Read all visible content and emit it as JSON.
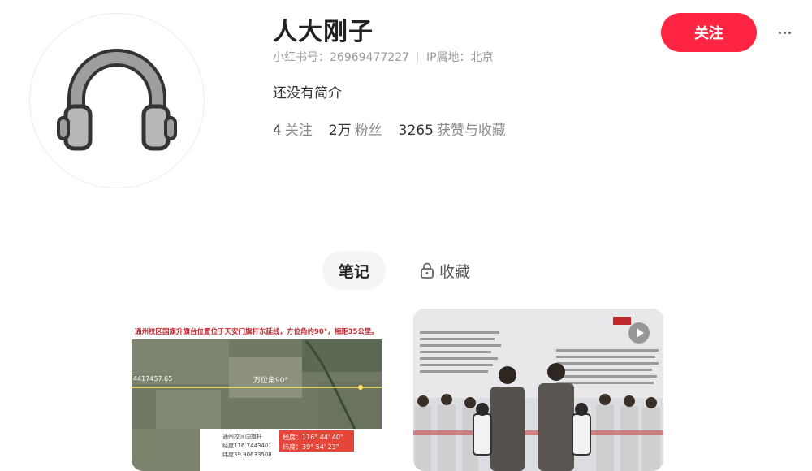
{
  "profile": {
    "avatar_icon": "headphones-icon",
    "nickname": "人大刚子",
    "redbook_id": "小红书号：26969477227",
    "ip_location": "IP属地：北京",
    "bio": "还没有简介",
    "stats": [
      {
        "num": "4",
        "label": "关注"
      },
      {
        "num": "2万",
        "label": "粉丝"
      },
      {
        "num": "3265",
        "label": "获赞与收藏"
      }
    ]
  },
  "actions": {
    "follow_label": "关注",
    "more_icon": "more-horizontal-icon"
  },
  "tabs": [
    {
      "label": "笔记",
      "active": true
    },
    {
      "label": "收藏",
      "active": false,
      "icon": "lock-icon"
    }
  ],
  "notes": [
    {
      "type": "image",
      "caption": "通州校区国旗升旗台位置位于天安门旗杆东延线，方位角约90°，相距35公里。",
      "map_labels": {
        "mid_label": "万位角90°",
        "coord_left": "4417457.65",
        "box1_l1": "通州校区国旗杆",
        "box1_l2": "经度116.7443401",
        "box1_l3": "纬度39.90633508",
        "box2_l1": "经度：116° 44' 40\"",
        "box2_l2": "纬度：39° 54' 23\""
      }
    },
    {
      "type": "video",
      "icon": "play-icon"
    }
  ],
  "colors": {
    "brand_red": "#ff2442",
    "text_main": "#333333",
    "text_muted": "#9a9a9a"
  }
}
